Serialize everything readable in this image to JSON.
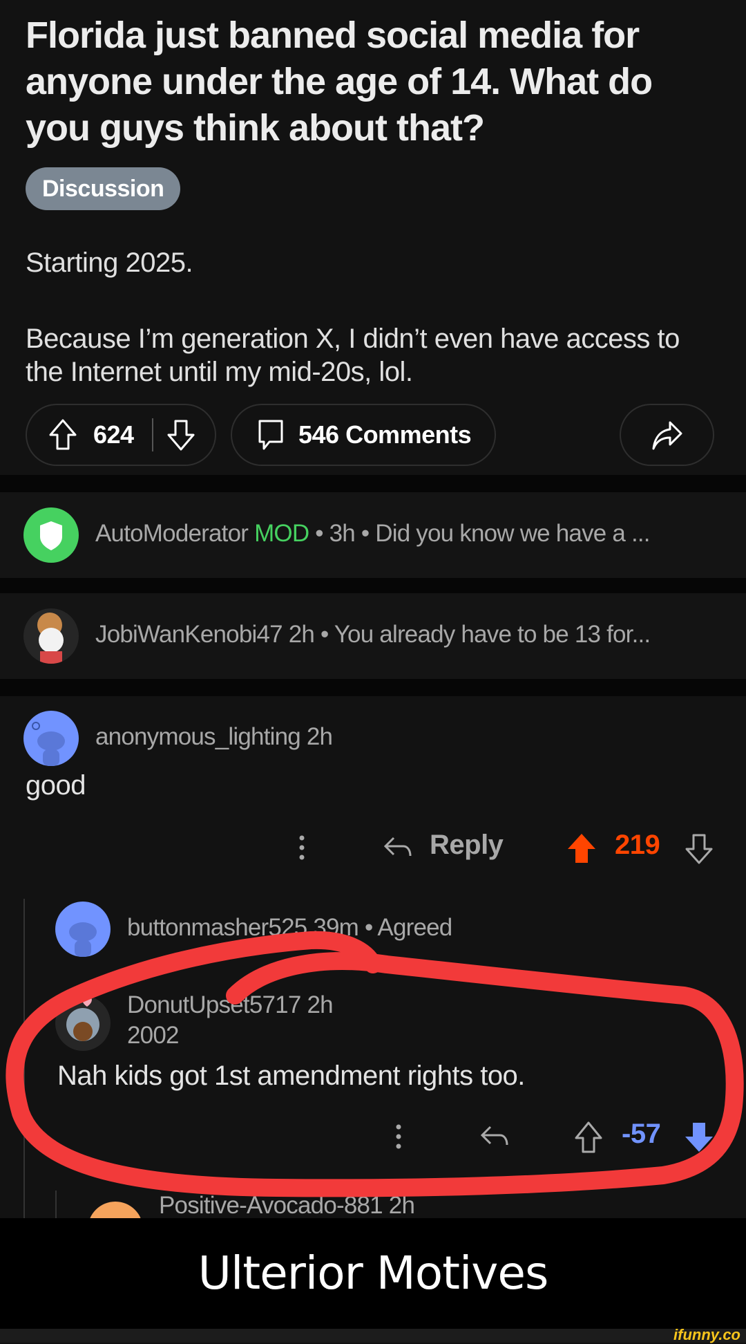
{
  "post": {
    "title": "Florida just banned social media for anyone under the age of 14. What do you guys think about that?",
    "flair": "Discussion",
    "body_lines": [
      "Starting 2025.",
      "Because I’m generation X, I didn’t even have access to the Internet until my mid-20s, lol."
    ],
    "votes": "624",
    "comments_label": "546 Comments"
  },
  "collapsed_comments": [
    {
      "user": "AutoModerator",
      "badge": "MOD",
      "meta": " • 3h • Did you know we have a ..."
    },
    {
      "user": "JobiWanKenobi47",
      "meta": " 2h • You already have to be 13 for..."
    }
  ],
  "comment": {
    "user": "anonymous_lighting",
    "time": "2h",
    "text": "good",
    "reply_label": "Reply",
    "votes": "219"
  },
  "replies": [
    {
      "user": "buttonmasher525",
      "meta": " 39m • Agreed"
    },
    {
      "user": "DonutUpset5717",
      "time": "2h",
      "flair": "2002",
      "text": "Nah kids got 1st amendment rights too.",
      "votes": "-57"
    },
    {
      "user": "Positive-Avocado-881",
      "time": "2h"
    }
  ],
  "caption": "Ulterior Motives",
  "watermark": "ifunny.co",
  "colors": {
    "upvote": "#ff4500",
    "downvote": "#7193ff",
    "mod": "#46d160",
    "annotation": "#f23a3a",
    "watermark": "#f8c51c"
  }
}
